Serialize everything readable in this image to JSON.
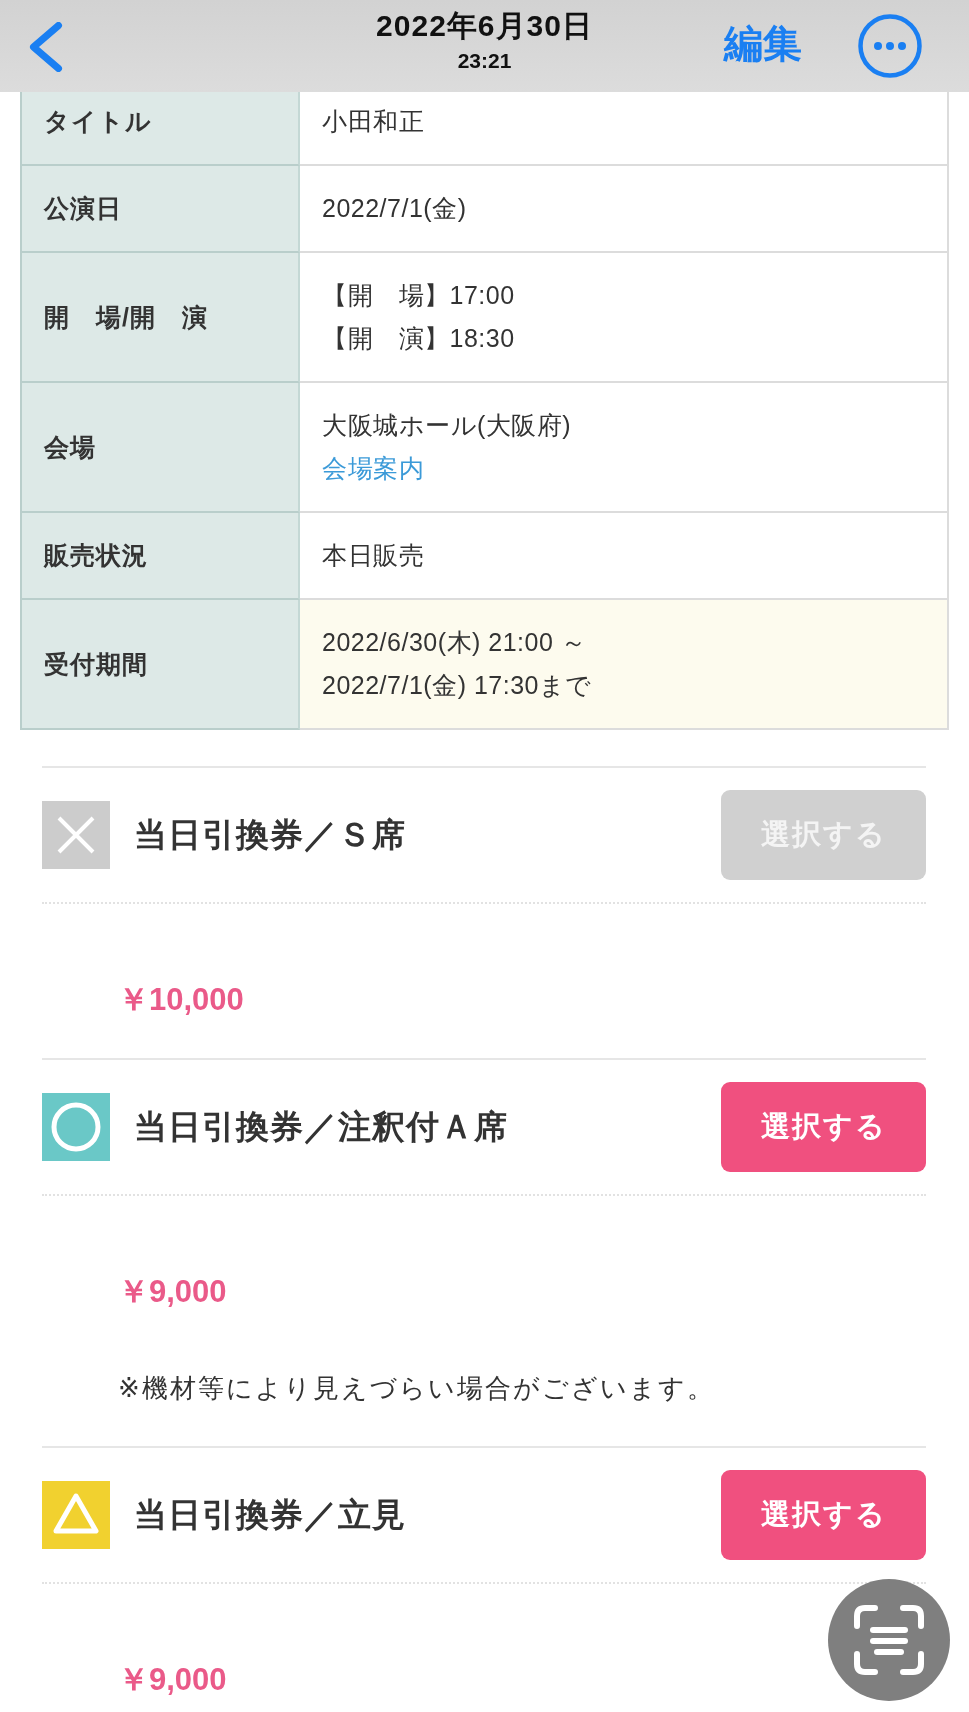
{
  "header": {
    "title": "2022年6月30日",
    "time": "23:21",
    "edit_label": "編集"
  },
  "details": [
    {
      "label": "タイトル",
      "lines": [
        "小田和正"
      ],
      "highlighted": false
    },
    {
      "label": "公演日",
      "lines": [
        "2022/7/1(金)"
      ],
      "highlighted": false
    },
    {
      "label": "開　場/開　演",
      "lines": [
        "【開　場】17:00",
        "【開　演】18:30"
      ],
      "highlighted": false
    },
    {
      "label": "会場",
      "lines": [
        "大阪城ホール(大阪府)"
      ],
      "link": "会場案内",
      "highlighted": false
    },
    {
      "label": "販売状況",
      "lines": [
        "本日販売"
      ],
      "highlighted": false
    },
    {
      "label": "受付期間",
      "lines": [
        "2022/6/30(木) 21:00 ～",
        "2022/7/1(金) 17:30まで"
      ],
      "highlighted": true
    }
  ],
  "tickets": [
    {
      "kind": "sold_out",
      "name": "当日引換券／Ｓ席",
      "button": "選択する",
      "disabled": true,
      "price": "￥10,000"
    },
    {
      "kind": "available",
      "name": "当日引換券／注釈付Ａ席",
      "button": "選択する",
      "disabled": false,
      "price": "￥9,000",
      "note": "※機材等により見えづらい場合がございます。"
    },
    {
      "kind": "few",
      "name": "当日引換券／立見",
      "button": "選択する",
      "disabled": false,
      "price": "￥9,000"
    }
  ]
}
